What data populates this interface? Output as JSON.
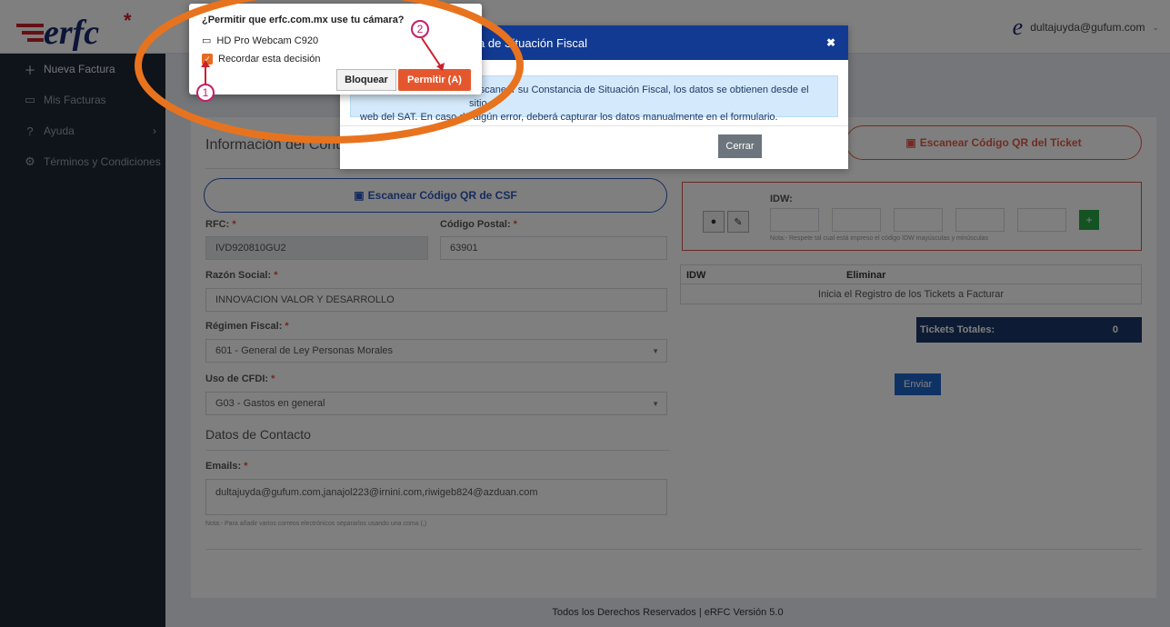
{
  "header": {
    "logo_text": "erfc",
    "user_email": "dultajuyda@gufum.com"
  },
  "sidebar": {
    "items": [
      {
        "label": "Nueva Factura",
        "icon": "plus-icon"
      },
      {
        "label": "Mis Facturas",
        "icon": "invoice-icon"
      },
      {
        "label": "Ayuda",
        "icon": "help-icon"
      },
      {
        "label": "Términos y Condiciones",
        "icon": "gear-icon"
      }
    ]
  },
  "form": {
    "contribuyente_title": "Información del Contribuyente",
    "scan_csf_label": "Escanear Código QR de CSF",
    "rfc_label": "RFC:",
    "rfc_value": "IVD920810GU2",
    "cp_label": "Código Postal:",
    "cp_value": "63901",
    "razon_label": "Razón Social:",
    "razon_value": "INNOVACION VALOR Y DESARROLLO",
    "regimen_label": "Régimen Fiscal:",
    "regimen_value": "601 - General de Ley Personas Morales",
    "uso_label": "Uso de CFDI:",
    "uso_value": "G03 - Gastos en general",
    "contacto_title": "Datos de Contacto",
    "emails_label": "Emails:",
    "emails_value": "dultajuyda@gufum.com,janajol223@irnini.com,riwigeb824@azduan.com",
    "emails_note": "Nota:- Para añadir varios correos electrónicos separarlos usando una coma (,)"
  },
  "tickets": {
    "scan_ticket_label": "Escanear Código QR del Ticket",
    "idw_label": "IDW:",
    "idw_note": "Nota:- Respete tal cual está impreso el código IDW mayúsculas y minúsculas",
    "col_idw": "IDW",
    "col_eliminar": "Eliminar",
    "empty_row": "Inicia el Registro de los Tickets a Facturar",
    "total_label": "Tickets Totales:",
    "total_value": "0",
    "plus_label": "+",
    "enviar_label": "Enviar"
  },
  "modal": {
    "title": "a de Situación Fiscal",
    "body_line1": "l escanear su Constancia de Situación Fiscal, los datos se obtienen desde el sitio",
    "body_line2": "web del SAT. En caso de algún error, deberá capturar los datos manualmente en el formulario.",
    "close_label": "Cerrar"
  },
  "permission": {
    "title": "¿Permitir que erfc.com.mx use tu cámara?",
    "camera": "HD Pro Webcam C920",
    "remember": "Recordar esta decisión",
    "block_label": "Bloquear",
    "allow_label": "Permitir (A)"
  },
  "annotations": {
    "badge1": "1",
    "badge2": "2",
    "highlight_color": "#e8731e",
    "arrow_color": "#cc1f2b"
  },
  "footer": {
    "text": "Todos los Derechos Reservados | eRFC Versión 5.0"
  }
}
